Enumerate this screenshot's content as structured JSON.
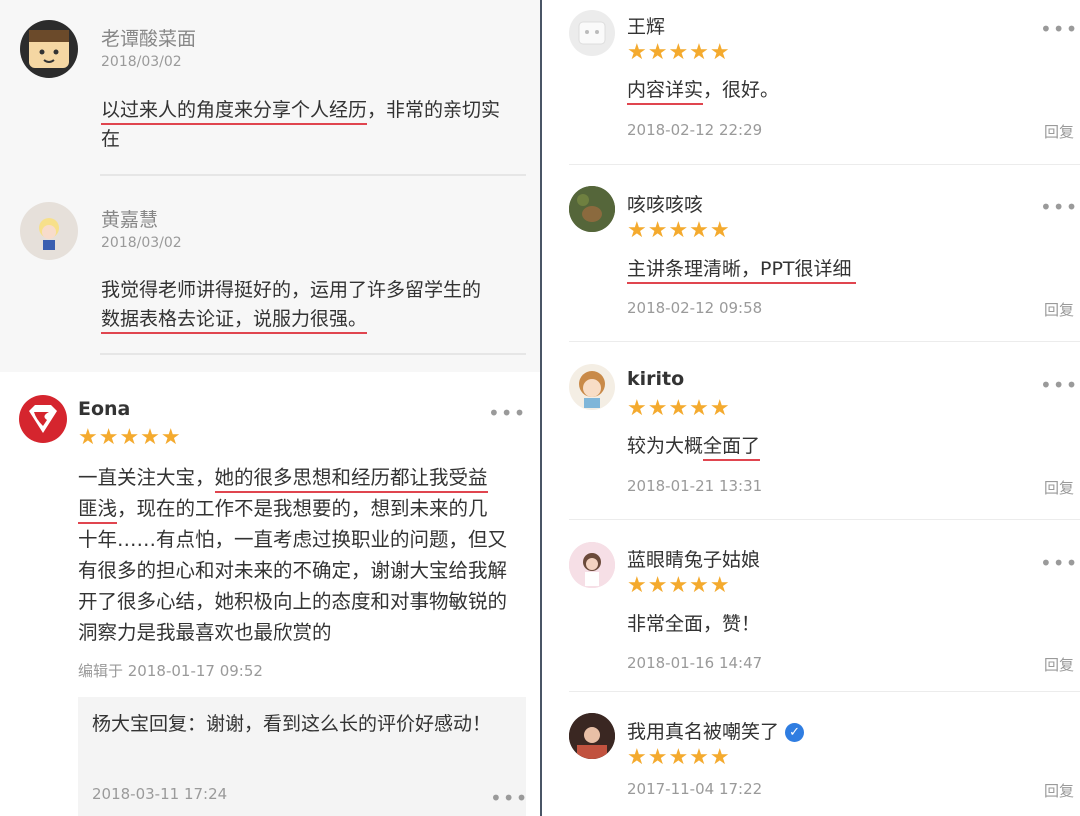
{
  "left": {
    "comments": [
      {
        "name": "老谭酸菜面",
        "date": "2018/03/02",
        "text_under": "以过来人的角度来分享个人经历",
        "text_rest": "，非常的亲切实在"
      },
      {
        "name": "黄嘉慧",
        "date": "2018/03/02",
        "text_line1": "我觉得老师讲得挺好的，运用了许多留学生的",
        "text_line2_under": "数据表格去论证，说服力很强。"
      }
    ],
    "review": {
      "name": "Eona",
      "stars": "★★★★★",
      "text_a": "一直关注大宝，",
      "text_b_under": "她的很多思想和经历都让我受益",
      "text_c_under": "匪浅",
      "text_d": "，现在的工作不是我想要的，想到未来的几",
      "text_e": "十年……有点怕，一直考虑过换职业的问题，但又有很多的担心和对未来的不确定，谢谢大宝给我解开了很多心结，她积极向上的态度和对事物敏锐的洞察力是我最喜欢也最欣赏的",
      "edited": "编辑于 2018-01-17 09:52",
      "reply_text": "杨大宝回复：谢谢，看到这么长的评价好感动！",
      "reply_date": "2018-03-11 17:24",
      "more": "•••"
    }
  },
  "right": {
    "reply_label": "回复",
    "more": "•••",
    "reviews": [
      {
        "name": "王辉",
        "stars": "★★★★★",
        "text_under": "内容详实",
        "text_rest": "，很好。",
        "date": "2018-02-12 22:29"
      },
      {
        "name": "咳咳咳咳",
        "stars": "★★★★★",
        "text_under": "主讲条理清晰，PPT很详细",
        "text_rest": "",
        "date": "2018-02-12 09:58"
      },
      {
        "name": "kirito",
        "stars": "★★★★★",
        "text_pre": "较为大概",
        "text_under": "全面了",
        "date": "2018-01-21 13:31"
      },
      {
        "name": "蓝眼睛兔子姑娘",
        "stars": "★★★★★",
        "text": "非常全面，赞！",
        "date": "2018-01-16 14:47"
      },
      {
        "name": "我用真名被嘲笑了",
        "verified_icon": "check-badge-icon",
        "stars": "★★★★★",
        "date": "2017-11-04 17:22"
      }
    ]
  },
  "colors": {
    "star": "#f4aa2e",
    "underline": "#e0454f",
    "divider": "#4a5566",
    "verified": "#2f7de1"
  }
}
